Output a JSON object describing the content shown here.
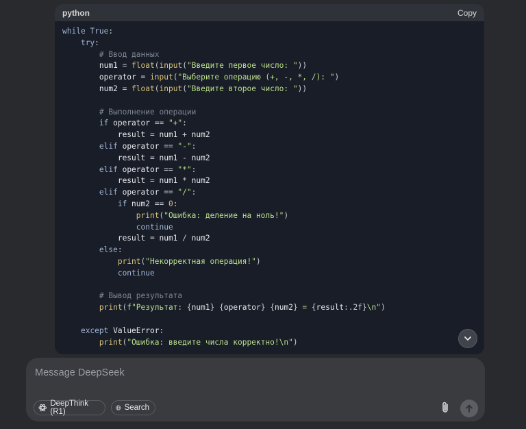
{
  "code_block": {
    "language": "python",
    "copy_label": "Copy",
    "lines": [
      [
        {
          "t": "kw",
          "v": "while True"
        },
        {
          "t": "op",
          "v": ":"
        }
      ],
      [
        {
          "t": "sp",
          "v": "    "
        },
        {
          "t": "kw",
          "v": "try"
        },
        {
          "t": "op",
          "v": ":"
        }
      ],
      [
        {
          "t": "sp",
          "v": "        "
        },
        {
          "t": "cmt",
          "v": "# Ввод данных"
        }
      ],
      [
        {
          "t": "sp",
          "v": "        "
        },
        {
          "t": "var",
          "v": "num1"
        },
        {
          "t": "op",
          "v": " = "
        },
        {
          "t": "fn",
          "v": "float"
        },
        {
          "t": "op",
          "v": "("
        },
        {
          "t": "fn",
          "v": "input"
        },
        {
          "t": "op",
          "v": "("
        },
        {
          "t": "str",
          "v": "\"Введите первое число: \""
        },
        {
          "t": "op",
          "v": "))"
        }
      ],
      [
        {
          "t": "sp",
          "v": "        "
        },
        {
          "t": "var",
          "v": "operator"
        },
        {
          "t": "op",
          "v": " = "
        },
        {
          "t": "fn",
          "v": "input"
        },
        {
          "t": "op",
          "v": "("
        },
        {
          "t": "str",
          "v": "\"Выберите операцию (+, -, *, /): \""
        },
        {
          "t": "op",
          "v": ")"
        }
      ],
      [
        {
          "t": "sp",
          "v": "        "
        },
        {
          "t": "var",
          "v": "num2"
        },
        {
          "t": "op",
          "v": " = "
        },
        {
          "t": "fn",
          "v": "float"
        },
        {
          "t": "op",
          "v": "("
        },
        {
          "t": "fn",
          "v": "input"
        },
        {
          "t": "op",
          "v": "("
        },
        {
          "t": "str",
          "v": "\"Введите второе число: \""
        },
        {
          "t": "op",
          "v": "))"
        }
      ],
      [],
      [
        {
          "t": "sp",
          "v": "        "
        },
        {
          "t": "cmt",
          "v": "# Выполнение операции"
        }
      ],
      [
        {
          "t": "sp",
          "v": "        "
        },
        {
          "t": "kw",
          "v": "if"
        },
        {
          "t": "var",
          "v": " operator"
        },
        {
          "t": "op",
          "v": " == "
        },
        {
          "t": "str",
          "v": "\"+\""
        },
        {
          "t": "op",
          "v": ":"
        }
      ],
      [
        {
          "t": "sp",
          "v": "            "
        },
        {
          "t": "var",
          "v": "result"
        },
        {
          "t": "op",
          "v": " = "
        },
        {
          "t": "var",
          "v": "num1"
        },
        {
          "t": "op",
          "v": " + "
        },
        {
          "t": "var",
          "v": "num2"
        }
      ],
      [
        {
          "t": "sp",
          "v": "        "
        },
        {
          "t": "kw",
          "v": "elif"
        },
        {
          "t": "var",
          "v": " operator"
        },
        {
          "t": "op",
          "v": " == "
        },
        {
          "t": "str",
          "v": "\"-\""
        },
        {
          "t": "op",
          "v": ":"
        }
      ],
      [
        {
          "t": "sp",
          "v": "            "
        },
        {
          "t": "var",
          "v": "result"
        },
        {
          "t": "op",
          "v": " = "
        },
        {
          "t": "var",
          "v": "num1"
        },
        {
          "t": "op",
          "v": " - "
        },
        {
          "t": "var",
          "v": "num2"
        }
      ],
      [
        {
          "t": "sp",
          "v": "        "
        },
        {
          "t": "kw",
          "v": "elif"
        },
        {
          "t": "var",
          "v": " operator"
        },
        {
          "t": "op",
          "v": " == "
        },
        {
          "t": "str",
          "v": "\"*\""
        },
        {
          "t": "op",
          "v": ":"
        }
      ],
      [
        {
          "t": "sp",
          "v": "            "
        },
        {
          "t": "var",
          "v": "result"
        },
        {
          "t": "op",
          "v": " = "
        },
        {
          "t": "var",
          "v": "num1"
        },
        {
          "t": "op",
          "v": " * "
        },
        {
          "t": "var",
          "v": "num2"
        }
      ],
      [
        {
          "t": "sp",
          "v": "        "
        },
        {
          "t": "kw",
          "v": "elif"
        },
        {
          "t": "var",
          "v": " operator"
        },
        {
          "t": "op",
          "v": " == "
        },
        {
          "t": "str",
          "v": "\"/\""
        },
        {
          "t": "op",
          "v": ":"
        }
      ],
      [
        {
          "t": "sp",
          "v": "            "
        },
        {
          "t": "kw",
          "v": "if"
        },
        {
          "t": "var",
          "v": " num2"
        },
        {
          "t": "op",
          "v": " == "
        },
        {
          "t": "num",
          "v": "0"
        },
        {
          "t": "op",
          "v": ":"
        }
      ],
      [
        {
          "t": "sp",
          "v": "                "
        },
        {
          "t": "fn",
          "v": "print"
        },
        {
          "t": "op",
          "v": "("
        },
        {
          "t": "str",
          "v": "\"Ошибка: деление на ноль!\""
        },
        {
          "t": "op",
          "v": ")"
        }
      ],
      [
        {
          "t": "sp",
          "v": "                "
        },
        {
          "t": "kw",
          "v": "continue"
        }
      ],
      [
        {
          "t": "sp",
          "v": "            "
        },
        {
          "t": "var",
          "v": "result"
        },
        {
          "t": "op",
          "v": " = "
        },
        {
          "t": "var",
          "v": "num1"
        },
        {
          "t": "op",
          "v": " / "
        },
        {
          "t": "var",
          "v": "num2"
        }
      ],
      [
        {
          "t": "sp",
          "v": "        "
        },
        {
          "t": "kw",
          "v": "else"
        },
        {
          "t": "op",
          "v": ":"
        }
      ],
      [
        {
          "t": "sp",
          "v": "            "
        },
        {
          "t": "fn",
          "v": "print"
        },
        {
          "t": "op",
          "v": "("
        },
        {
          "t": "str",
          "v": "\"Некорректная операция!\""
        },
        {
          "t": "op",
          "v": ")"
        }
      ],
      [
        {
          "t": "sp",
          "v": "            "
        },
        {
          "t": "kw",
          "v": "continue"
        }
      ],
      [],
      [
        {
          "t": "sp",
          "v": "        "
        },
        {
          "t": "cmt",
          "v": "# Вывод результата"
        }
      ],
      [
        {
          "t": "sp",
          "v": "        "
        },
        {
          "t": "fn",
          "v": "print"
        },
        {
          "t": "op",
          "v": "("
        },
        {
          "t": "str",
          "v": "f\"Результат: "
        },
        {
          "t": "op",
          "v": "{"
        },
        {
          "t": "var",
          "v": "num1"
        },
        {
          "t": "op",
          "v": "}"
        },
        {
          "t": "str",
          "v": " "
        },
        {
          "t": "op",
          "v": "{"
        },
        {
          "t": "var",
          "v": "operator"
        },
        {
          "t": "op",
          "v": "}"
        },
        {
          "t": "str",
          "v": " "
        },
        {
          "t": "op",
          "v": "{"
        },
        {
          "t": "var",
          "v": "num2"
        },
        {
          "t": "op",
          "v": "}"
        },
        {
          "t": "str",
          "v": " = "
        },
        {
          "t": "op",
          "v": "{"
        },
        {
          "t": "var",
          "v": "result"
        },
        {
          "t": "op",
          "v": ":.2f}"
        },
        {
          "t": "str",
          "v": "\\n\""
        },
        {
          "t": "op",
          "v": ")"
        }
      ],
      [],
      [
        {
          "t": "sp",
          "v": "    "
        },
        {
          "t": "kw",
          "v": "except"
        },
        {
          "t": "var",
          "v": " ValueError"
        },
        {
          "t": "op",
          "v": ":"
        }
      ],
      [
        {
          "t": "sp",
          "v": "        "
        },
        {
          "t": "fn",
          "v": "print"
        },
        {
          "t": "op",
          "v": "("
        },
        {
          "t": "str",
          "v": "\"Ошибка: введите числа корректно!\\n\""
        },
        {
          "t": "op",
          "v": ")"
        }
      ]
    ]
  },
  "composer": {
    "placeholder": "Message DeepSeek",
    "deepthink_label": "DeepThink (R1)",
    "search_label": "Search"
  },
  "icons": {
    "scroll": "chevron-down-icon",
    "deepthink": "atom-icon",
    "search": "globe-icon",
    "attach": "paperclip-icon",
    "send": "arrow-up-icon"
  },
  "colors": {
    "background": "#292a2d",
    "code_bg": "#181d27",
    "input_bg": "#3a3b3f"
  }
}
